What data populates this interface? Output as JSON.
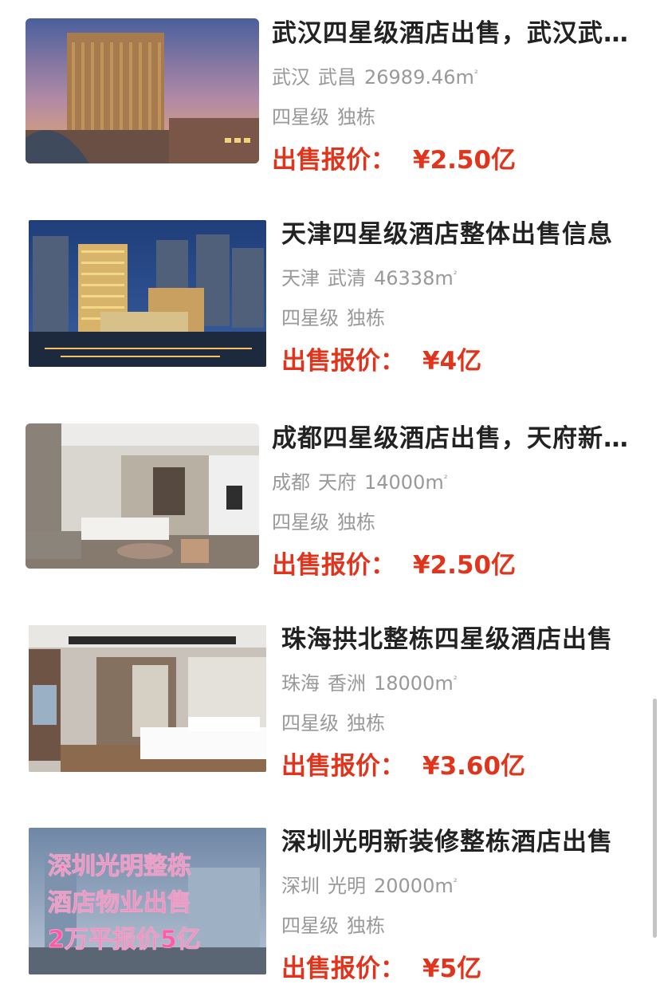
{
  "listings": [
    {
      "title": "武汉四星级酒店出售，武汉武昌整栋酒店出售",
      "city": "武汉",
      "district": "武昌",
      "area": "26989.46",
      "unit": "m",
      "unit_sup": "²",
      "tags": [
        "四星级",
        "独栋"
      ],
      "price_label": "出售报价：",
      "price": "¥2.50亿"
    },
    {
      "title": "天津四星级酒店整体出售信息",
      "city": "天津",
      "district": "武清",
      "area": "46338",
      "unit": "m",
      "unit_sup": "²",
      "tags": [
        "四星级",
        "独栋"
      ],
      "price_label": "出售报价：",
      "price": "¥4亿"
    },
    {
      "title": "成都四星级酒店出售，天府新区整栋酒店",
      "city": "成都",
      "district": "天府",
      "area": "14000",
      "unit": "m",
      "unit_sup": "²",
      "tags": [
        "四星级",
        "独栋"
      ],
      "price_label": "出售报价：",
      "price": "¥2.50亿"
    },
    {
      "title": "珠海拱北整栋四星级酒店出售",
      "city": "珠海",
      "district": "香洲",
      "area": "18000",
      "unit": "m",
      "unit_sup": "²",
      "tags": [
        "四星级",
        "独栋"
      ],
      "price_label": "出售报价：",
      "price": "¥3.60亿"
    },
    {
      "title": "深圳光明新装修整栋酒店出售",
      "city": "深圳",
      "district": "光明",
      "area": "20000",
      "unit": "m",
      "unit_sup": "²",
      "tags": [
        "四星级",
        "独栋"
      ],
      "price_label": "出售报价：",
      "price": "¥5亿",
      "image_overlay": [
        "深圳光明整栋",
        "酒店物业出售",
        "2万平报价5亿"
      ]
    }
  ],
  "colors": {
    "price": "#e0341c",
    "title": "#222222",
    "meta": "#999999"
  }
}
